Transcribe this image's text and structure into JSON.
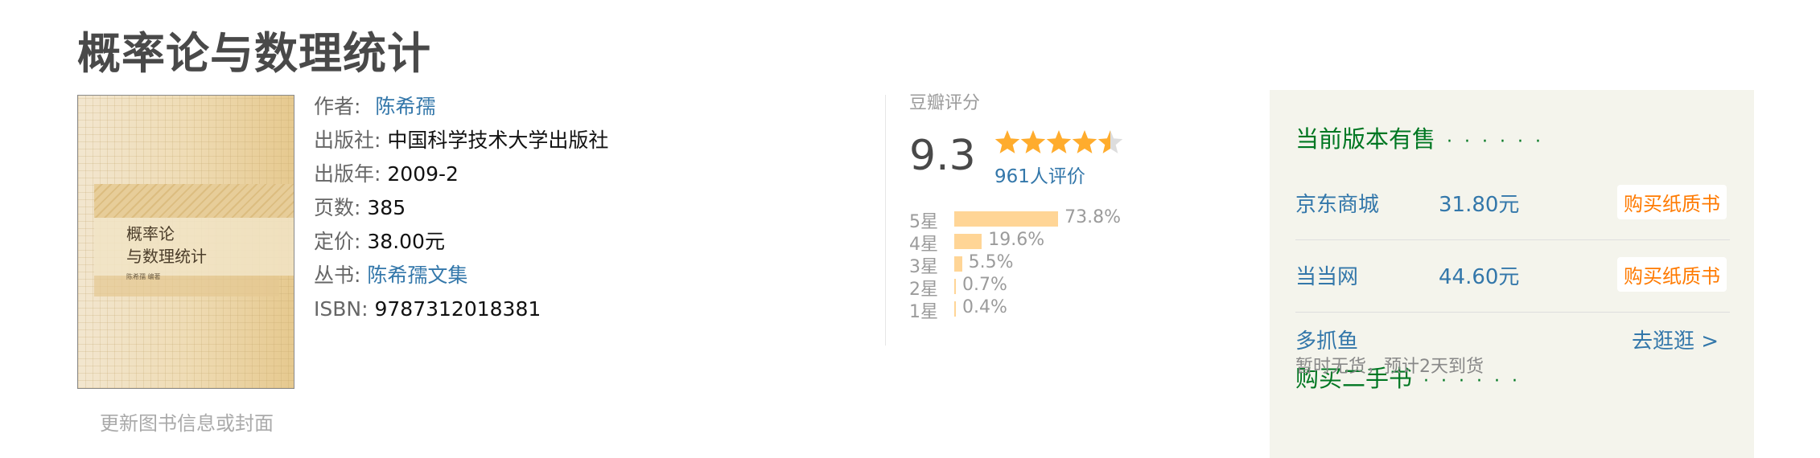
{
  "book": {
    "title": "概率论与数理统计",
    "cover_title": "概率论\n与数理统计",
    "cover_author": "陈希孺 编著",
    "update_link": "更新图书信息或封面",
    "info": {
      "author_label": "作者:",
      "author": "陈希孺",
      "publisher_label": "出版社:",
      "publisher": "中国科学技术大学出版社",
      "year_label": "出版年:",
      "year": "2009-2",
      "pages_label": "页数:",
      "pages": "385",
      "price_label": "定价:",
      "price": "38.00元",
      "series_label": "丛书:",
      "series": "陈希孺文集",
      "isbn_label": "ISBN:",
      "isbn": "9787312018381"
    }
  },
  "rating": {
    "label": "豆瓣评分",
    "score": "9.3",
    "stars": 4.5,
    "count": "961人评价",
    "distribution": [
      {
        "label": "5星",
        "percent": "73.8%",
        "value": 73.8
      },
      {
        "label": "4星",
        "percent": "19.6%",
        "value": 19.6
      },
      {
        "label": "3星",
        "percent": "5.5%",
        "value": 5.5
      },
      {
        "label": "2星",
        "percent": "0.7%",
        "value": 0.7
      },
      {
        "label": "1星",
        "percent": "0.4%",
        "value": 0.4
      }
    ]
  },
  "sidebar": {
    "current_title": "当前版本有售",
    "dots": "· · · · · ·",
    "vendors": [
      {
        "name": "京东商城",
        "price": "31.80元",
        "buy": "购买纸质书"
      },
      {
        "name": "当当网",
        "price": "44.60元",
        "buy": "购买纸质书"
      }
    ],
    "used_title": "购买二手书",
    "used_vendor": "多抓鱼",
    "used_go": "去逛逛 >",
    "used_status": "暂时无货，预计2天到货"
  },
  "colors": {
    "link": "#3377aa",
    "green": "#007722",
    "star": "#ffac2d",
    "bar": "#ffd596",
    "buy": "#ff7a00"
  }
}
